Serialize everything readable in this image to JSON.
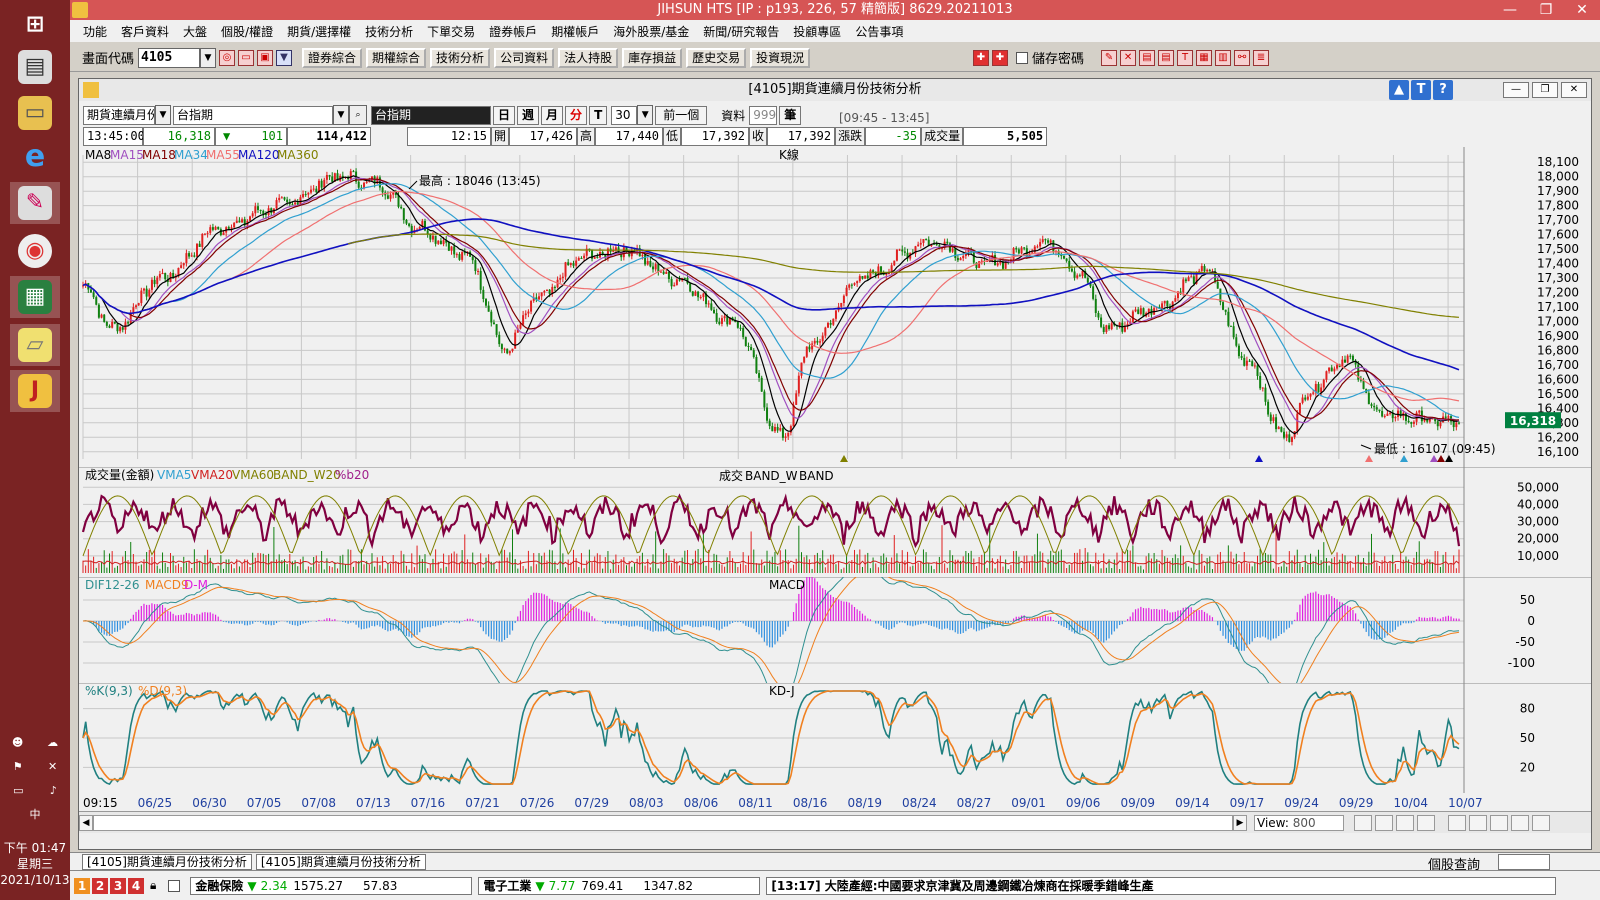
{
  "window_title": "JIHSUN HTS    [IP : p193, 226, 57 精簡版] 8629.20211013",
  "menu": [
    "功能",
    "客戶資料",
    "大盤",
    "個股/權證",
    "期貨/選擇權",
    "技術分析",
    "下單交易",
    "證券帳戶",
    "期權帳戶",
    "海外股票/基金",
    "新聞/研究報告",
    "投顧專區",
    "公告事項"
  ],
  "toolbar": {
    "code_label": "畫面代碼",
    "code_value": "4105",
    "buttons": [
      "證券綜合",
      "期權綜合",
      "技術分析",
      "公司資料",
      "法人持股",
      "庫存損益",
      "歷史交易",
      "投資現況"
    ],
    "save_password": "儲存密碼"
  },
  "chart_window": {
    "title": "[4105]期貨連續月份技術分析",
    "product_type": "期貨連續月份",
    "symbol_input": "台指期",
    "symbol_display": "台指期",
    "periods": [
      "日",
      "週",
      "月",
      "分"
    ],
    "active_period": "分",
    "t_button": "T",
    "interval": "30",
    "prev_button": "前一個",
    "data_label": "資料",
    "data_count": "999",
    "data_unit": "筆",
    "range": "[09:45 - 13:45]"
  },
  "quote": {
    "time": "13:45:00",
    "price": "16,318",
    "change": "101",
    "volume_total": "114,412",
    "bar_time": "12:15",
    "open_label": "開",
    "open": "17,426",
    "high_label": "高",
    "high": "17,440",
    "low_label": "低",
    "low": "17,392",
    "close_label": "收",
    "close": "17,392",
    "chg_label": "漲跌",
    "chg": "-35",
    "vol_label": "成交量",
    "vol": "5,505"
  },
  "colors": {
    "ma8": "#000000",
    "ma15": "#a050c0",
    "ma18": "#800000",
    "ma34": "#30a0d0",
    "ma55": "#f07070",
    "ma120": "#1010c0",
    "ma360": "#808000",
    "vol_line": "#800040",
    "dif": "#309090",
    "macd": "#f08020",
    "dm": "#e020e0",
    "k": "#208080",
    "d": "#f08020"
  },
  "k_panel": {
    "title": "K線",
    "legend": [
      "MA8",
      "MA15",
      "MA18",
      "MA34",
      "MA55",
      "MA120",
      "MA360"
    ],
    "high_label": "最高 : 18046 (13:45)",
    "low_label": "最低 : 16107 (09:45)",
    "last_price": "16,318",
    "y_ticks": [
      18100,
      18000,
      17900,
      17800,
      17700,
      17600,
      17500,
      17400,
      17300,
      17200,
      17100,
      17000,
      16900,
      16800,
      16700,
      16600,
      16500,
      16400,
      16300,
      16200,
      16100
    ]
  },
  "v_panel": {
    "title": "成交量(金額)",
    "legend": [
      "VMA5",
      "VMA20",
      "VMA60",
      "BAND_W20",
      "%b20"
    ],
    "tags": [
      "成交",
      "BAND_W",
      "BAND"
    ],
    "y_ticks": [
      "50,000",
      "40,000",
      "30,000",
      "20,000",
      "10,000"
    ]
  },
  "m_panel": {
    "title": "MACD",
    "legend": [
      "DIF12-26",
      "MACD9",
      "D-M"
    ],
    "y_ticks": [
      "50",
      "0",
      "-50",
      "-100"
    ]
  },
  "kd_panel": {
    "title": "KD-J",
    "legend": [
      "%K(9,3)",
      "%D(9,3)"
    ],
    "y_ticks": [
      "80",
      "50",
      "20"
    ]
  },
  "x_labels": [
    "09:15",
    "06/25",
    "06/30",
    "07/05",
    "07/08",
    "07/13",
    "07/16",
    "07/21",
    "07/26",
    "07/29",
    "08/03",
    "08/06",
    "08/11",
    "08/16",
    "08/19",
    "08/24",
    "08/27",
    "09/01",
    "09/06",
    "09/09",
    "09/14",
    "09/17",
    "09/24",
    "09/29",
    "10/04",
    "10/07"
  ],
  "scroll": {
    "view_label": "View:",
    "view_value": "800"
  },
  "bottom_tabs": [
    "[4105]期貨連續月份技術分析",
    "[4105]期貨連續月份技術分析"
  ],
  "bottom_right": "個股查詢",
  "ticker": {
    "nums": [
      "1",
      "2",
      "3",
      "4"
    ],
    "item1_name": "金融保險",
    "item1_chg": "2.34",
    "item1_val": "1575.27",
    "item1_x": "57.83",
    "item2_name": "電子工業",
    "item2_chg": "7.77",
    "item2_val": "769.41",
    "item2_x": "1347.82",
    "news": "[13:17]  大陸產經:中國要求京津冀及周邊鋼鐵冶煉商在採暖季錯峰生產"
  },
  "taskbar": {
    "clock_time": "下午 01:47",
    "clock_day": "星期三",
    "clock_date": "2021/10/13",
    "ime": "中"
  }
}
